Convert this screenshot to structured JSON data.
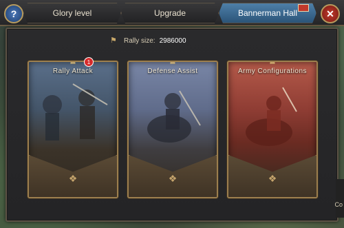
{
  "tabs": [
    {
      "label": "Glory level",
      "active": false
    },
    {
      "label": "Upgrade",
      "active": false
    },
    {
      "label": "Bannerman Hall",
      "active": true
    }
  ],
  "header": {
    "help_icon": "question-icon",
    "close_icon": "close-icon"
  },
  "rally": {
    "label": "Rally size:",
    "value": "2986000"
  },
  "cards": [
    {
      "title": "Rally Attack",
      "badge": "1"
    },
    {
      "title": "Defense Assist"
    },
    {
      "title": "Army Configurations"
    }
  ],
  "corner": {
    "text": "Co"
  },
  "colors": {
    "active_tab": "#3f6f96",
    "close_button": "#c0392b",
    "help_button": "#2f5f9e",
    "gold_border": "#9c7f4e"
  }
}
